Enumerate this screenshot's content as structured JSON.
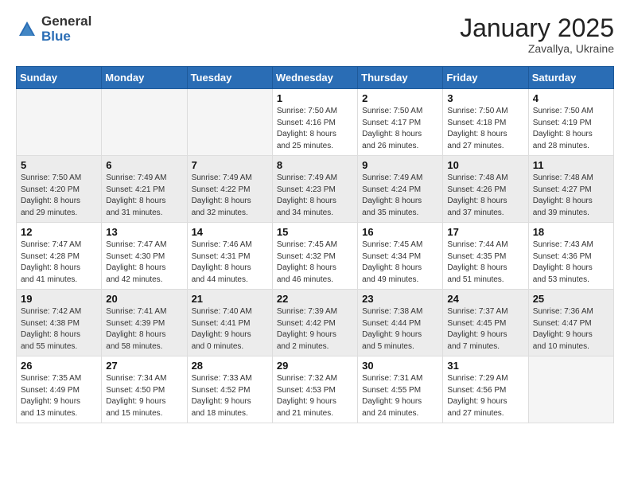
{
  "header": {
    "logo_general": "General",
    "logo_blue": "Blue",
    "month": "January 2025",
    "location": "Zavallya, Ukraine"
  },
  "weekdays": [
    "Sunday",
    "Monday",
    "Tuesday",
    "Wednesday",
    "Thursday",
    "Friday",
    "Saturday"
  ],
  "weeks": [
    [
      {
        "day": "",
        "info": ""
      },
      {
        "day": "",
        "info": ""
      },
      {
        "day": "",
        "info": ""
      },
      {
        "day": "1",
        "info": "Sunrise: 7:50 AM\nSunset: 4:16 PM\nDaylight: 8 hours\nand 25 minutes."
      },
      {
        "day": "2",
        "info": "Sunrise: 7:50 AM\nSunset: 4:17 PM\nDaylight: 8 hours\nand 26 minutes."
      },
      {
        "day": "3",
        "info": "Sunrise: 7:50 AM\nSunset: 4:18 PM\nDaylight: 8 hours\nand 27 minutes."
      },
      {
        "day": "4",
        "info": "Sunrise: 7:50 AM\nSunset: 4:19 PM\nDaylight: 8 hours\nand 28 minutes."
      }
    ],
    [
      {
        "day": "5",
        "info": "Sunrise: 7:50 AM\nSunset: 4:20 PM\nDaylight: 8 hours\nand 29 minutes."
      },
      {
        "day": "6",
        "info": "Sunrise: 7:49 AM\nSunset: 4:21 PM\nDaylight: 8 hours\nand 31 minutes."
      },
      {
        "day": "7",
        "info": "Sunrise: 7:49 AM\nSunset: 4:22 PM\nDaylight: 8 hours\nand 32 minutes."
      },
      {
        "day": "8",
        "info": "Sunrise: 7:49 AM\nSunset: 4:23 PM\nDaylight: 8 hours\nand 34 minutes."
      },
      {
        "day": "9",
        "info": "Sunrise: 7:49 AM\nSunset: 4:24 PM\nDaylight: 8 hours\nand 35 minutes."
      },
      {
        "day": "10",
        "info": "Sunrise: 7:48 AM\nSunset: 4:26 PM\nDaylight: 8 hours\nand 37 minutes."
      },
      {
        "day": "11",
        "info": "Sunrise: 7:48 AM\nSunset: 4:27 PM\nDaylight: 8 hours\nand 39 minutes."
      }
    ],
    [
      {
        "day": "12",
        "info": "Sunrise: 7:47 AM\nSunset: 4:28 PM\nDaylight: 8 hours\nand 41 minutes."
      },
      {
        "day": "13",
        "info": "Sunrise: 7:47 AM\nSunset: 4:30 PM\nDaylight: 8 hours\nand 42 minutes."
      },
      {
        "day": "14",
        "info": "Sunrise: 7:46 AM\nSunset: 4:31 PM\nDaylight: 8 hours\nand 44 minutes."
      },
      {
        "day": "15",
        "info": "Sunrise: 7:45 AM\nSunset: 4:32 PM\nDaylight: 8 hours\nand 46 minutes."
      },
      {
        "day": "16",
        "info": "Sunrise: 7:45 AM\nSunset: 4:34 PM\nDaylight: 8 hours\nand 49 minutes."
      },
      {
        "day": "17",
        "info": "Sunrise: 7:44 AM\nSunset: 4:35 PM\nDaylight: 8 hours\nand 51 minutes."
      },
      {
        "day": "18",
        "info": "Sunrise: 7:43 AM\nSunset: 4:36 PM\nDaylight: 8 hours\nand 53 minutes."
      }
    ],
    [
      {
        "day": "19",
        "info": "Sunrise: 7:42 AM\nSunset: 4:38 PM\nDaylight: 8 hours\nand 55 minutes."
      },
      {
        "day": "20",
        "info": "Sunrise: 7:41 AM\nSunset: 4:39 PM\nDaylight: 8 hours\nand 58 minutes."
      },
      {
        "day": "21",
        "info": "Sunrise: 7:40 AM\nSunset: 4:41 PM\nDaylight: 9 hours\nand 0 minutes."
      },
      {
        "day": "22",
        "info": "Sunrise: 7:39 AM\nSunset: 4:42 PM\nDaylight: 9 hours\nand 2 minutes."
      },
      {
        "day": "23",
        "info": "Sunrise: 7:38 AM\nSunset: 4:44 PM\nDaylight: 9 hours\nand 5 minutes."
      },
      {
        "day": "24",
        "info": "Sunrise: 7:37 AM\nSunset: 4:45 PM\nDaylight: 9 hours\nand 7 minutes."
      },
      {
        "day": "25",
        "info": "Sunrise: 7:36 AM\nSunset: 4:47 PM\nDaylight: 9 hours\nand 10 minutes."
      }
    ],
    [
      {
        "day": "26",
        "info": "Sunrise: 7:35 AM\nSunset: 4:49 PM\nDaylight: 9 hours\nand 13 minutes."
      },
      {
        "day": "27",
        "info": "Sunrise: 7:34 AM\nSunset: 4:50 PM\nDaylight: 9 hours\nand 15 minutes."
      },
      {
        "day": "28",
        "info": "Sunrise: 7:33 AM\nSunset: 4:52 PM\nDaylight: 9 hours\nand 18 minutes."
      },
      {
        "day": "29",
        "info": "Sunrise: 7:32 AM\nSunset: 4:53 PM\nDaylight: 9 hours\nand 21 minutes."
      },
      {
        "day": "30",
        "info": "Sunrise: 7:31 AM\nSunset: 4:55 PM\nDaylight: 9 hours\nand 24 minutes."
      },
      {
        "day": "31",
        "info": "Sunrise: 7:29 AM\nSunset: 4:56 PM\nDaylight: 9 hours\nand 27 minutes."
      },
      {
        "day": "",
        "info": ""
      }
    ]
  ],
  "row_colors": [
    "light",
    "gray",
    "light",
    "gray",
    "light"
  ]
}
